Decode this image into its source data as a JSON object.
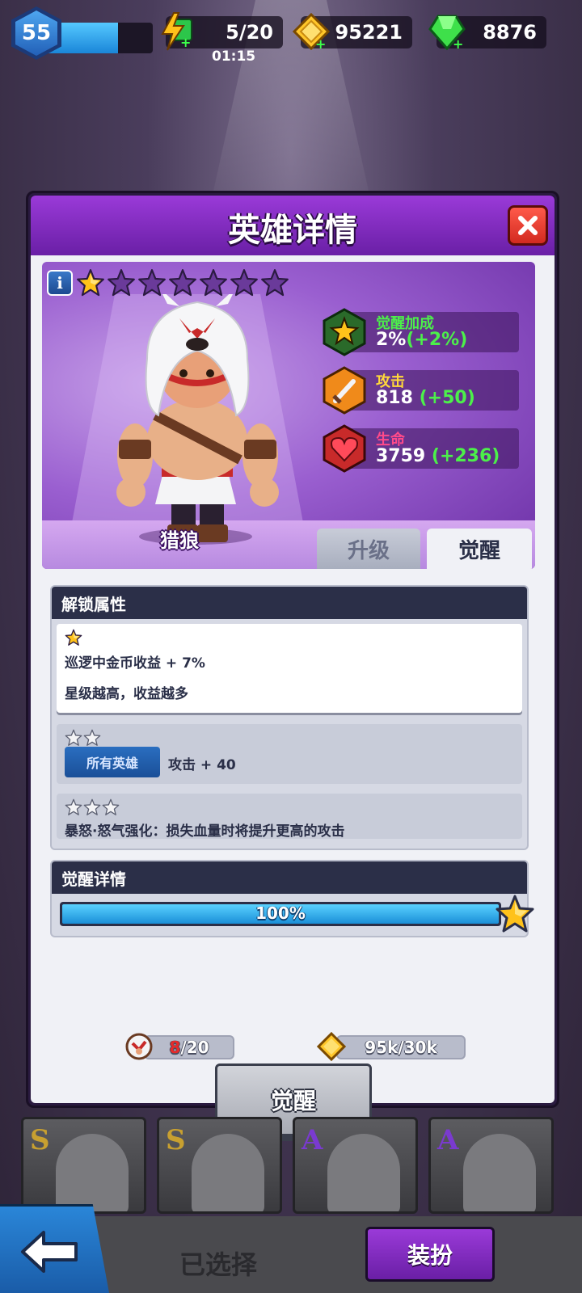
{
  "topbar": {
    "level": "55",
    "level_progress": 0.68,
    "energy": "5/20",
    "energy_timer": "01:15",
    "gold": "95221",
    "gems": "8876"
  },
  "modal": {
    "title": "英雄详情",
    "hero": {
      "name": "猎狼",
      "stars_total": 7,
      "stars_filled": 1,
      "stats": [
        {
          "label": "觉醒加成",
          "value": "2%",
          "bonus": "(+2%)",
          "label_color": "#4cf04a",
          "icon": "star-badge-icon"
        },
        {
          "label": "攻击",
          "value": "818 ",
          "bonus": "(+50)",
          "label_color": "#ffd83a",
          "icon": "sword-badge-icon"
        },
        {
          "label": "生命",
          "value": "3759 ",
          "bonus": "(+236)",
          "label_color": "#ff4a8a",
          "icon": "heart-badge-icon"
        }
      ]
    },
    "tabs": {
      "upgrade": "升级",
      "awaken": "觉醒"
    },
    "unlock": {
      "title": "解锁属性",
      "items": [
        {
          "stars": 1,
          "line1": "巡逻中金币收益 + 7%",
          "line2": "星级越高，收益越多"
        },
        {
          "stars": 2,
          "tag": "所有英雄",
          "text": "攻击 + 40"
        },
        {
          "stars": 3,
          "text": "暴怒·怒气强化：损失血量时将提升更高的攻击"
        }
      ]
    },
    "awaken": {
      "title": "觉醒详情",
      "progress": 1.0,
      "progress_label": "100%",
      "shard_have": "8",
      "shard_need": "/20",
      "gold_cost": "95k/30k"
    },
    "awaken_button": "觉醒"
  },
  "cards": [
    {
      "rank": "S",
      "rank_color": "#c8a030"
    },
    {
      "rank": "S",
      "rank_color": "#c8a030"
    },
    {
      "rank": "A",
      "rank_color": "#7a3ad0"
    },
    {
      "rank": "A",
      "rank_color": "#7a3ad0"
    }
  ],
  "bottom": {
    "selected": "已选择",
    "dress": "装扮"
  }
}
